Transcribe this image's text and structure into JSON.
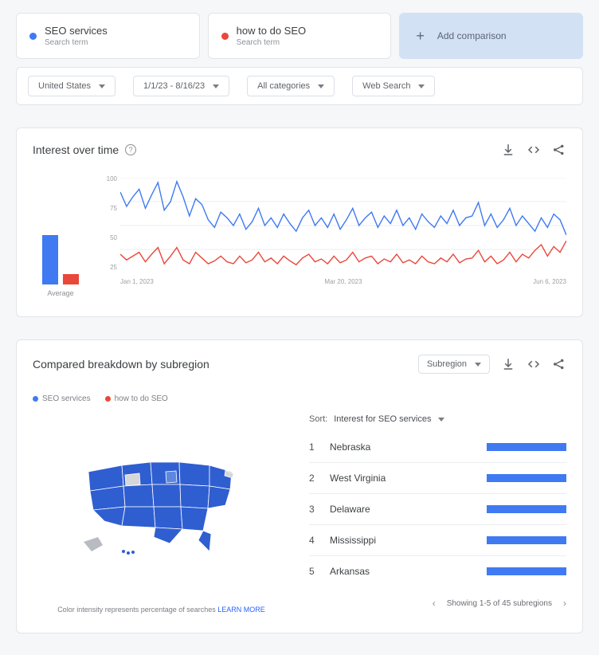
{
  "compare": {
    "term1": {
      "label": "SEO services",
      "sub": "Search term",
      "color": "#3f7af3"
    },
    "term2": {
      "label": "how to do SEO",
      "sub": "Search term",
      "color": "#e9483a"
    },
    "add_label": "Add comparison"
  },
  "filters": {
    "region": "United States",
    "date_range": "1/1/23 - 8/16/23",
    "category": "All categories",
    "search_type": "Web Search"
  },
  "interest_panel": {
    "title": "Interest over time",
    "avg_label": "Average",
    "y_ticks": [
      "100",
      "75",
      "50",
      "25"
    ],
    "x_ticks": [
      "Jan 1, 2023",
      "Mar 20, 2023",
      "Jun 6, 2023"
    ]
  },
  "chart_data": {
    "type": "line",
    "title": "Interest over time",
    "ylabel": "",
    "ylim": [
      0,
      100
    ],
    "x": [
      "Jan 1, 2023",
      "Mar 20, 2023",
      "Jun 6, 2023"
    ],
    "series": [
      {
        "name": "SEO services",
        "color": "#3f7af3",
        "values": [
          85,
          70,
          80,
          88,
          68,
          82,
          95,
          66,
          75,
          96,
          80,
          60,
          78,
          72,
          56,
          48,
          64,
          58,
          50,
          62,
          46,
          54,
          68,
          50,
          58,
          48,
          62,
          52,
          44,
          58,
          66,
          50,
          58,
          48,
          62,
          46,
          56,
          68,
          50,
          58,
          64,
          48,
          60,
          52,
          66,
          50,
          58,
          46,
          62,
          54,
          48,
          60,
          52,
          66,
          50,
          58,
          60,
          74,
          50,
          62,
          48,
          56,
          68,
          50,
          60,
          52,
          44,
          58,
          48,
          62,
          56,
          40
        ]
      },
      {
        "name": "how to do SEO",
        "color": "#e9483a",
        "values": [
          20,
          14,
          18,
          22,
          12,
          20,
          27,
          10,
          18,
          27,
          14,
          10,
          22,
          16,
          10,
          13,
          18,
          12,
          10,
          18,
          11,
          14,
          22,
          12,
          16,
          10,
          18,
          13,
          9,
          16,
          20,
          12,
          15,
          10,
          18,
          11,
          14,
          22,
          12,
          16,
          18,
          10,
          15,
          12,
          20,
          11,
          14,
          10,
          18,
          12,
          10,
          16,
          12,
          20,
          11,
          15,
          16,
          24,
          12,
          18,
          10,
          14,
          22,
          12,
          20,
          16,
          24,
          30,
          18,
          28,
          22,
          34
        ]
      }
    ],
    "avg_bar": {
      "series1": 55,
      "series2": 12
    }
  },
  "region_panel": {
    "title": "Compared breakdown by subregion",
    "subregion_chip": "Subregion",
    "legend": {
      "a": "SEO services",
      "b": "how to do SEO"
    },
    "sort_label": "Sort:",
    "sort_value": "Interest for SEO services",
    "rows": [
      {
        "rank": "1",
        "name": "Nebraska",
        "bar": 100
      },
      {
        "rank": "2",
        "name": "West Virginia",
        "bar": 100
      },
      {
        "rank": "3",
        "name": "Delaware",
        "bar": 100
      },
      {
        "rank": "4",
        "name": "Mississippi",
        "bar": 100
      },
      {
        "rank": "5",
        "name": "Arkansas",
        "bar": 100
      }
    ],
    "caption_text": "Color intensity represents percentage of searches ",
    "caption_link": "LEARN MORE",
    "pager_text": "Showing 1-5 of 45 subregions"
  }
}
